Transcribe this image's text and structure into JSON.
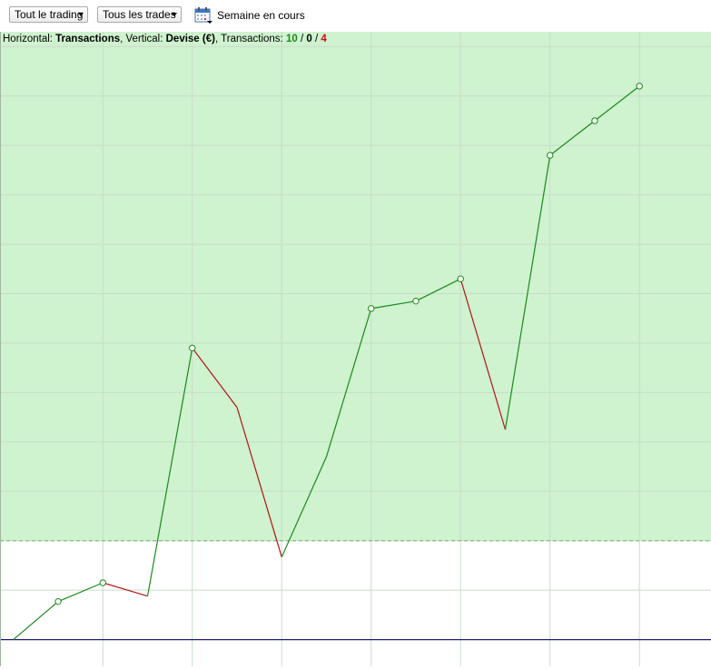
{
  "toolbar": {
    "trading_filter": "Tout le trading",
    "trades_filter": "Tous les trades",
    "period_label": "Semaine en cours",
    "calendar_icon": "calendar-icon"
  },
  "legend": {
    "horizontal_prefix": "Horizontal: ",
    "horizontal_value": "Transactions",
    "vertical_prefix": ", Vertical: ",
    "vertical_value": "Devise (€)",
    "transactions_prefix": ", Transactions: ",
    "wins": "10",
    "sep1": " / ",
    "even": "0",
    "sep2": " / ",
    "losses": "4"
  },
  "colors": {
    "profit_zone": "#cff2cf",
    "win_line": "#1a8a1a",
    "loss_line": "#b01515",
    "grid": "#c9dcc9",
    "baseline": "#1e1e7a",
    "threshold": "#6cb86c"
  },
  "chart_data": {
    "type": "line",
    "x": [
      0,
      1,
      2,
      3,
      4,
      5,
      6,
      7,
      8,
      9,
      10,
      11,
      12,
      13,
      14
    ],
    "values": [
      0,
      0.77,
      1.15,
      0.88,
      5.9,
      4.7,
      1.67,
      3.7,
      6.7,
      6.85,
      7.3,
      4.25,
      9.8,
      10.5,
      11.2
    ],
    "segment_result": [
      "win",
      "win",
      "loss",
      "win",
      "loss",
      "loss",
      "win",
      "win",
      "win",
      "win",
      "loss",
      "win",
      "win",
      "win"
    ],
    "markers": [
      1,
      2,
      4,
      8,
      9,
      10,
      12,
      13,
      14
    ],
    "profit_threshold": 2,
    "xlim": [
      -0.3,
      15.6
    ],
    "ylim": [
      -0.54,
      12.3
    ],
    "x_grid": [
      2,
      4,
      6,
      8,
      10,
      12,
      14
    ],
    "y_grid": [
      0,
      1,
      2,
      3,
      4,
      5,
      6,
      7,
      8,
      9,
      10,
      11,
      12
    ],
    "grid": true,
    "legend_position": "top-left"
  }
}
